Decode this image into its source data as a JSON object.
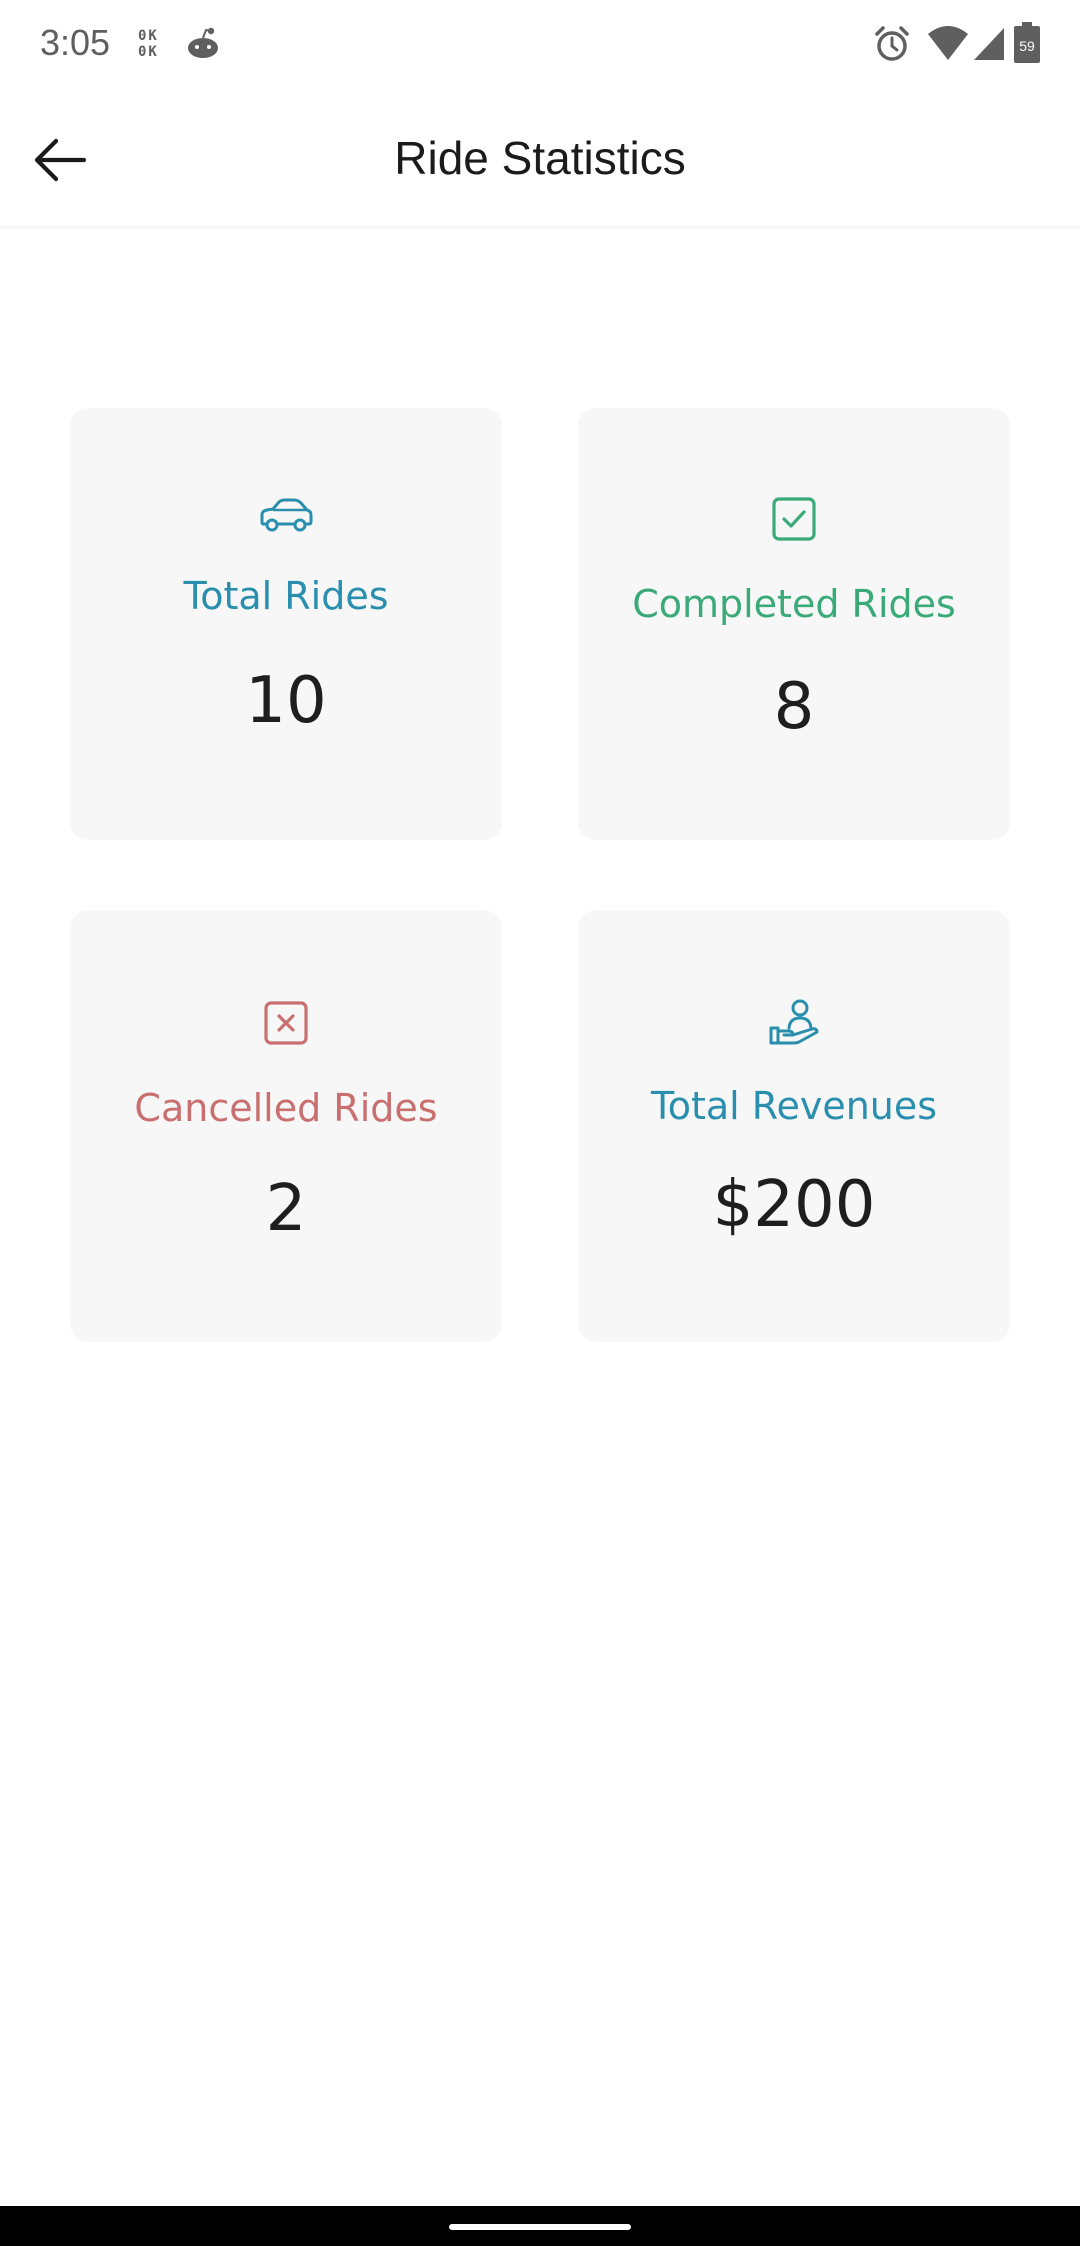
{
  "status_bar": {
    "time": "3:05",
    "ok_line1": "0K",
    "ok_line2": "0K",
    "battery_level": "59"
  },
  "header": {
    "title": "Ride Statistics"
  },
  "colors": {
    "total_rides": "#2a8fae",
    "completed_rides": "#3aaa78",
    "cancelled_rides": "#c96f6f",
    "total_revenues": "#2a8fae",
    "card_background": "#f7f7f7"
  },
  "stats": {
    "total_rides": {
      "label": "Total Rides",
      "value": "10",
      "icon": "car-icon"
    },
    "completed_rides": {
      "label": "Completed Rides",
      "value": "8",
      "icon": "check-square-icon"
    },
    "cancelled_rides": {
      "label": "Cancelled Rides",
      "value": "2",
      "icon": "x-square-icon"
    },
    "total_revenues": {
      "label": "Total Revenues",
      "value": "$200",
      "icon": "hand-user-icon"
    }
  }
}
